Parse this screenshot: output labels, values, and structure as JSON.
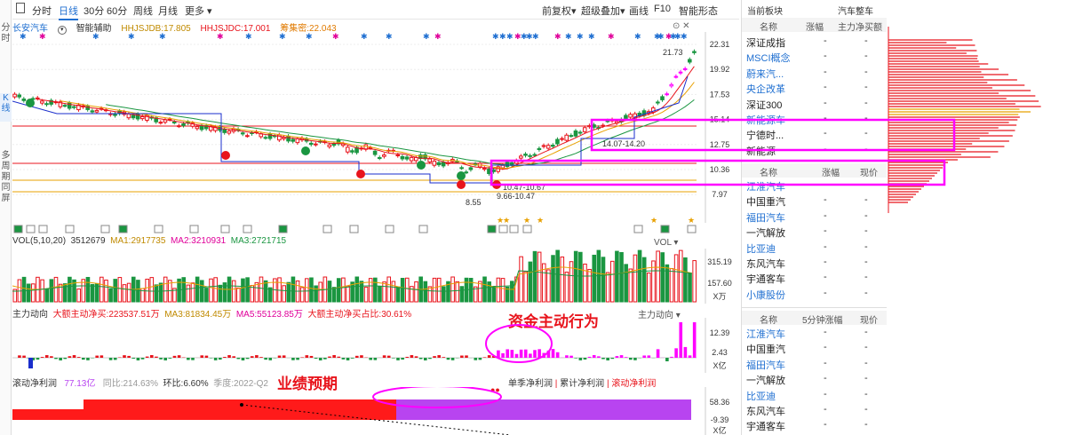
{
  "left_tabs": [
    "分时",
    "K线",
    "多周期同屏"
  ],
  "toolbar": {
    "items": [
      "分时",
      "日线",
      "30分",
      "60分",
      "周线",
      "月线",
      "更多 ▾"
    ],
    "active_index": 1,
    "right_items": [
      "前复权▾",
      "超级叠加▾",
      "画线",
      "F10",
      "智能形态"
    ]
  },
  "legend": {
    "stock_name": "长安汽车",
    "indicator": "智能辅助",
    "hhjsjdb": "HHJSJDB:17.805",
    "hhjsjdc": "HHJSJDC:17.001",
    "chip": "筹集密:22.043"
  },
  "price_axis": [
    "22.31",
    "19.92",
    "17.53",
    "15.14",
    "12.75",
    "10.36",
    "7.97"
  ],
  "price_annotations": {
    "high": "21.73",
    "low": "8.55",
    "range1": "10.47-10.67",
    "range2": "9.66-10.47",
    "range3": "14.07-14.20"
  },
  "volume": {
    "title": "VOL(5,10,20)",
    "value": "3512679",
    "ma1": "MA1:2917735",
    "ma2": "MA2:3210931",
    "ma3": "MA3:2721715",
    "right_label": "VOL ▾",
    "axis": [
      "315.19",
      "157.60",
      "X万"
    ]
  },
  "main_flow": {
    "title": "主力动向",
    "big_net": "大额主动净买:223537.51万",
    "ma3": "MA3:81834.45万",
    "ma5": "MA5:55123.85万",
    "ratio": "大额主动净买占比:30.61%",
    "right_label": "主力动向 ▾",
    "axis": [
      "12.39",
      "2.43",
      "X亿"
    ]
  },
  "profit": {
    "title": "滚动净利润",
    "value": "77.13亿",
    "yoy": "同比:214.63%",
    "qoq": "环比:6.60%",
    "season": "季度:2022-Q2",
    "buttons": [
      "单季净利润",
      "累计净利润",
      "滚动净利润"
    ],
    "axis": [
      "58.36",
      "-9.39",
      "X亿"
    ]
  },
  "annotations": {
    "capital": "资金主动行为",
    "earnings": "业绩预期"
  },
  "panel1": {
    "title": "当前板块",
    "subtitle": "汽车整车",
    "headers": [
      "名称",
      "涨幅",
      "主力净买额"
    ],
    "rows": [
      {
        "name": "深证成指",
        "c1": "-",
        "c2": "-",
        "link": false
      },
      {
        "name": "MSCI概念",
        "c1": "-",
        "c2": "-",
        "link": true
      },
      {
        "name": "蔚来汽...",
        "c1": "-",
        "c2": "-",
        "link": true
      },
      {
        "name": "央企改革",
        "c1": "-",
        "c2": "-",
        "link": true
      },
      {
        "name": "深证300",
        "c1": "-",
        "c2": "-",
        "link": false
      },
      {
        "name": "新能源车",
        "c1": "-",
        "c2": "-",
        "link": true
      },
      {
        "name": "宁德时...",
        "c1": "-",
        "c2": "-",
        "link": false
      },
      {
        "name": "新能源",
        "c1": "-",
        "c2": "-",
        "link": false
      }
    ]
  },
  "panel2": {
    "headers": [
      "名称",
      "涨幅",
      "现价"
    ],
    "rows": [
      {
        "name": "江淮汽车",
        "c1": "-",
        "c2": "-",
        "link": true
      },
      {
        "name": "中国重汽",
        "c1": "-",
        "c2": "-",
        "link": false
      },
      {
        "name": "福田汽车",
        "c1": "-",
        "c2": "-",
        "link": true
      },
      {
        "name": "一汽解放",
        "c1": "-",
        "c2": "-",
        "link": false
      },
      {
        "name": "比亚迪",
        "c1": "-",
        "c2": "-",
        "link": true
      },
      {
        "name": "东风汽车",
        "c1": "-",
        "c2": "-",
        "link": false
      },
      {
        "name": "宇通客车",
        "c1": "-",
        "c2": "-",
        "link": false
      },
      {
        "name": "小康股份",
        "c1": "-",
        "c2": "-",
        "link": true
      }
    ]
  },
  "panel3": {
    "headers": [
      "名称",
      "5分钟涨幅",
      "现价"
    ],
    "rows": [
      {
        "name": "江淮汽车",
        "c1": "-",
        "c2": "-",
        "link": true
      },
      {
        "name": "中国重汽",
        "c1": "-",
        "c2": "-",
        "link": false
      },
      {
        "name": "福田汽车",
        "c1": "-",
        "c2": "-",
        "link": true
      },
      {
        "name": "一汽解放",
        "c1": "-",
        "c2": "-",
        "link": false
      },
      {
        "name": "比亚迪",
        "c1": "-",
        "c2": "-",
        "link": true
      },
      {
        "name": "东风汽车",
        "c1": "-",
        "c2": "-",
        "link": false
      },
      {
        "name": "宇通客车",
        "c1": "-",
        "c2": "-",
        "link": false
      }
    ]
  },
  "colors": {
    "up": "#e8141c",
    "down": "#1a9641",
    "accent": "#1f6fd1",
    "magenta": "#ff00ff",
    "purple": "#b844f0"
  }
}
